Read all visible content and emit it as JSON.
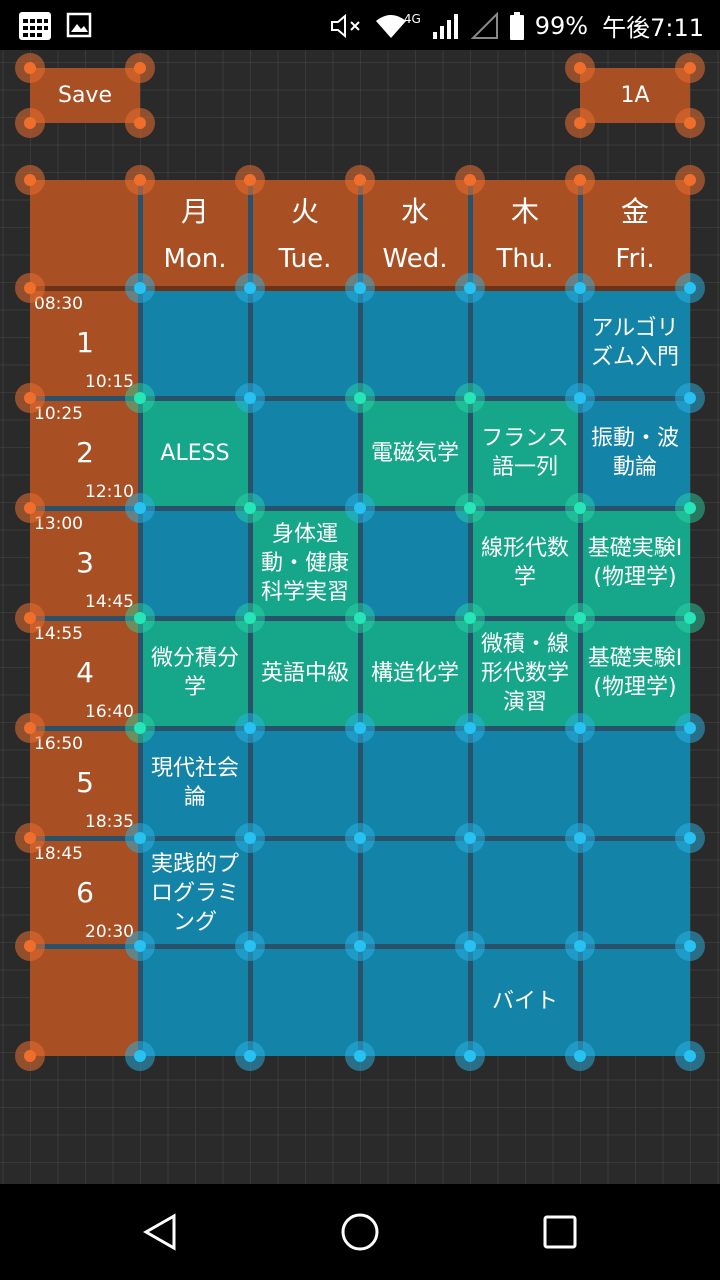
{
  "status_bar": {
    "battery": "99%",
    "time": "午後7:11",
    "network": "4G"
  },
  "toolbar": {
    "save_label": "Save",
    "class_label": "1A"
  },
  "days": [
    {
      "kanji": "月",
      "en": "Mon."
    },
    {
      "kanji": "火",
      "en": "Tue."
    },
    {
      "kanji": "水",
      "en": "Wed."
    },
    {
      "kanji": "木",
      "en": "Thu."
    },
    {
      "kanji": "金",
      "en": "Fri."
    }
  ],
  "periods": [
    {
      "num": "1",
      "start": "08:30",
      "end": "10:15"
    },
    {
      "num": "2",
      "start": "10:25",
      "end": "12:10"
    },
    {
      "num": "3",
      "start": "13:00",
      "end": "14:45"
    },
    {
      "num": "4",
      "start": "14:55",
      "end": "16:40"
    },
    {
      "num": "5",
      "start": "16:50",
      "end": "18:35"
    },
    {
      "num": "6",
      "start": "18:45",
      "end": "20:30"
    }
  ],
  "timetable": {
    "p1": {
      "fri": "アルゴリズム入門"
    },
    "p2": {
      "mon": "ALESS",
      "wed": "電磁気学",
      "thu": "フランス語一列",
      "fri": "振動・波動論"
    },
    "p3": {
      "tue": "身体運動・健康科学実習",
      "thu": "線形代数学",
      "fri": "基礎実験I (物理学)"
    },
    "p4": {
      "mon": "微分積分学",
      "tue": "英語中級",
      "wed": "構造化学",
      "thu": "微積・線形代数学演習",
      "fri": "基礎実験I (物理学)"
    },
    "p5": {
      "mon": "現代社会論"
    },
    "p6": {
      "mon": "実践的プログラミング"
    },
    "extra": "バイト"
  },
  "colors": {
    "orange": "#a84f23",
    "blue": "#1483a8",
    "green": "#16a689",
    "background": "#2a2a2a"
  }
}
